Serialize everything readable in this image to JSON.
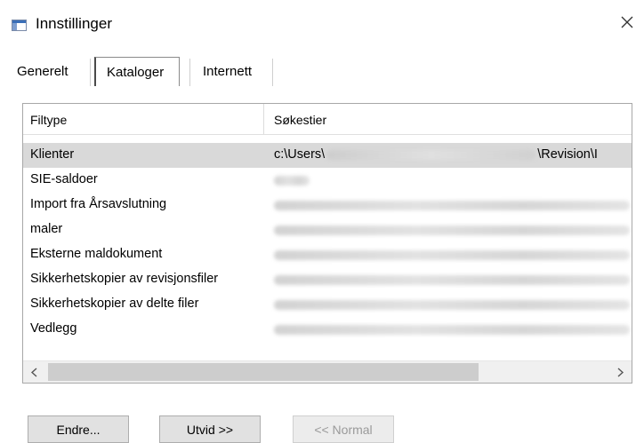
{
  "window": {
    "title": "Innstillinger"
  },
  "tabs": [
    {
      "label": "Generelt"
    },
    {
      "label": "Kataloger"
    },
    {
      "label": "Internett"
    }
  ],
  "list": {
    "columns": [
      "Filtype",
      "Søkestier"
    ],
    "rows": [
      {
        "type": "Klienter",
        "path_start": "c:\\Users\\",
        "path_end": "\\Revision\\I"
      },
      {
        "type": "SIE-saldoer"
      },
      {
        "type": "Import fra Årsavslutning"
      },
      {
        "type": "maler"
      },
      {
        "type": "Eksterne maldokument"
      },
      {
        "type": "Sikkerhetskopier av revisjonsfiler"
      },
      {
        "type": "Sikkerhetskopier av delte filer"
      },
      {
        "type": "Vedlegg"
      }
    ],
    "selected_row": 0
  },
  "buttons": {
    "edit": "Endre...",
    "expand": "Utvid >>",
    "normal": "<< Normal"
  },
  "icons": {
    "close": "close-icon",
    "scroll_left": "chevron-left-icon",
    "scroll_right": "chevron-right-icon"
  }
}
